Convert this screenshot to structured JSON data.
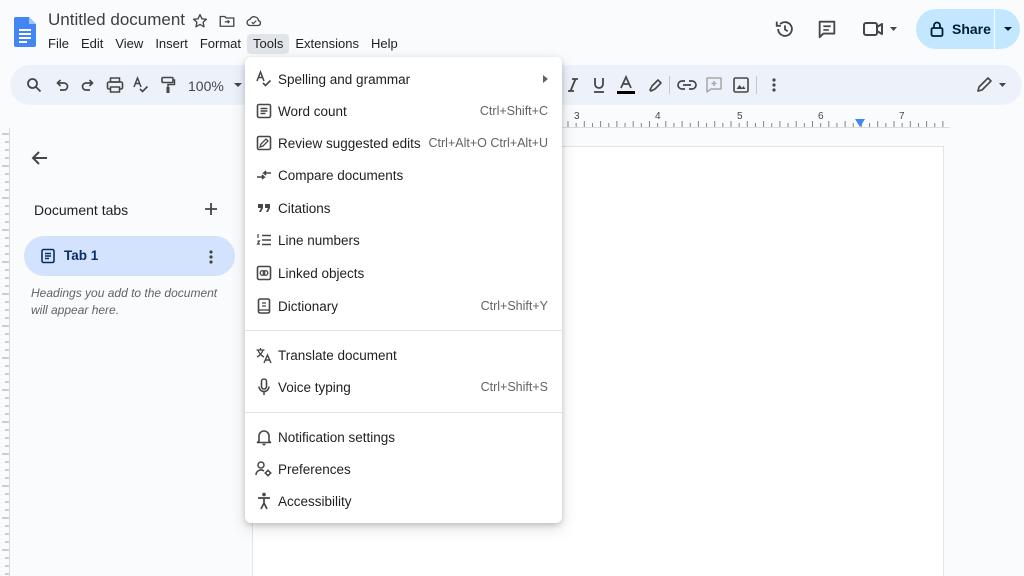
{
  "header": {
    "doc_title": "Untitled document",
    "menu": [
      "File",
      "Edit",
      "View",
      "Insert",
      "Format",
      "Tools",
      "Extensions",
      "Help"
    ],
    "active_menu": "Tools",
    "share_label": "Share"
  },
  "toolbar": {
    "zoom": "100%"
  },
  "ruler": {
    "numbers": [
      "3",
      "4",
      "5",
      "6",
      "7"
    ]
  },
  "sidebar": {
    "title": "Document tabs",
    "tab_label": "Tab 1",
    "hint": "Headings you add to the document will appear here."
  },
  "tools_menu": {
    "items": [
      {
        "label": "Spelling and grammar",
        "shortcut": "",
        "submenu": true,
        "icon": "spellcheck-icon"
      },
      {
        "label": "Word count",
        "shortcut": "Ctrl+Shift+C",
        "icon": "word-count-icon"
      },
      {
        "label": "Review suggested edits",
        "shortcut": "Ctrl+Alt+O Ctrl+Alt+U",
        "icon": "review-edits-icon"
      },
      {
        "label": "Compare documents",
        "shortcut": "",
        "icon": "compare-icon"
      },
      {
        "label": "Citations",
        "shortcut": "",
        "icon": "quote-icon"
      },
      {
        "label": "Line numbers",
        "shortcut": "",
        "icon": "line-numbers-icon"
      },
      {
        "label": "Linked objects",
        "shortcut": "",
        "icon": "linked-objects-icon"
      },
      {
        "label": "Dictionary",
        "shortcut": "Ctrl+Shift+Y",
        "icon": "dictionary-icon"
      },
      {
        "label": "Translate document",
        "shortcut": "",
        "icon": "translate-icon"
      },
      {
        "label": "Voice typing",
        "shortcut": "Ctrl+Shift+S",
        "icon": "microphone-icon"
      },
      {
        "label": "Notification settings",
        "shortcut": "",
        "icon": "bell-icon"
      },
      {
        "label": "Preferences",
        "shortcut": "",
        "icon": "preferences-icon"
      },
      {
        "label": "Accessibility",
        "shortcut": "",
        "icon": "accessibility-icon"
      }
    ]
  },
  "colors": {
    "accent": "#1a73e8",
    "share_bg": "#c2e7ff",
    "tab_bg": "#d3e3fd",
    "toolbar_bg": "#edf2fa"
  }
}
